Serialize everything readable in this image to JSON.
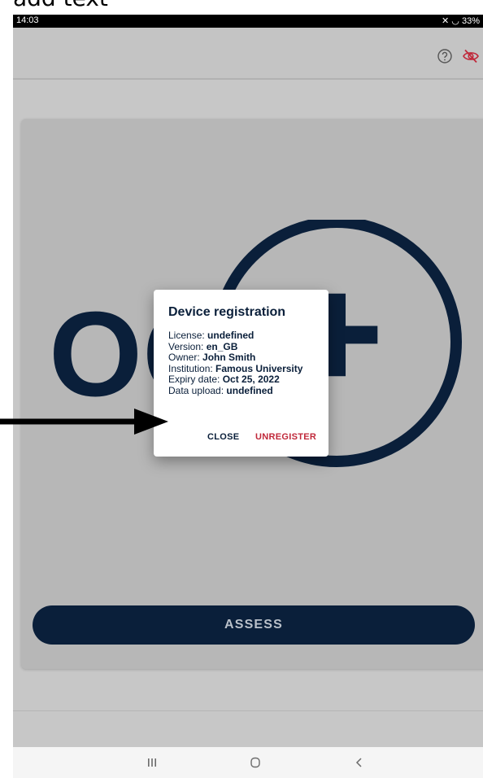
{
  "annotation": {
    "text": "add text"
  },
  "status_bar": {
    "time": "14:03",
    "battery": "33%"
  },
  "colors": {
    "navy": "#0a1f3a",
    "unregister_red": "#c0283a",
    "eye_icon_red": "#c0283a"
  },
  "app_bar": {
    "icons": [
      {
        "name": "help-icon"
      },
      {
        "name": "eye-off-icon"
      }
    ]
  },
  "logo": {
    "text": "OC",
    "plus_symbol": "+"
  },
  "main": {
    "assess_label": "ASSESS"
  },
  "dialog": {
    "title": "Device registration",
    "fields": [
      {
        "label": "License:",
        "value": "undefined"
      },
      {
        "label": "Version:",
        "value": "en_GB"
      },
      {
        "label": "Owner:",
        "value": "John Smith"
      },
      {
        "label": "Institution:",
        "value": "Famous University"
      },
      {
        "label": "Expiry date:",
        "value": "Oct 25, 2022"
      },
      {
        "label": "Data upload:",
        "value": "undefined"
      }
    ],
    "close_label": "CLOSE",
    "unregister_label": "UNREGISTER"
  },
  "nav_bar": {
    "recent_icon": "III",
    "home_icon": "O",
    "back_icon": "<"
  }
}
